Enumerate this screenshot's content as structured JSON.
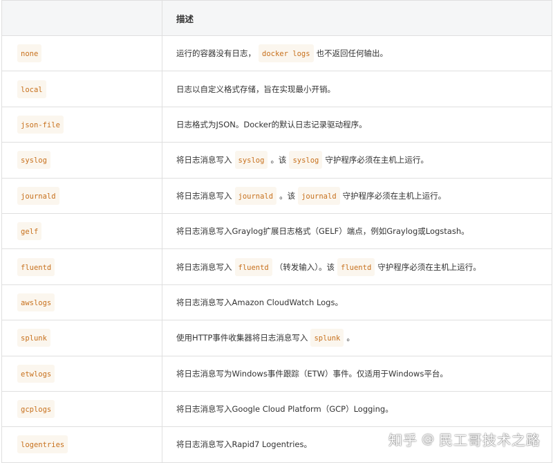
{
  "table": {
    "headers": [
      "",
      "描述"
    ],
    "rows": [
      {
        "name": "none",
        "desc": [
          {
            "t": "运行的容器没有日志，"
          },
          {
            "code": "docker logs"
          },
          {
            "t": "也不返回任何输出。"
          }
        ]
      },
      {
        "name": "local",
        "desc": [
          {
            "t": "日志以自定义格式存储，旨在实现最小开销。"
          }
        ]
      },
      {
        "name": "json-file",
        "desc": [
          {
            "t": "日志格式为JSON。Docker的默认日志记录驱动程序。"
          }
        ]
      },
      {
        "name": "syslog",
        "desc": [
          {
            "t": "将日志消息写入"
          },
          {
            "code": "syslog"
          },
          {
            "t": "。该"
          },
          {
            "code": "syslog"
          },
          {
            "t": "守护程序必须在主机上运行。"
          }
        ]
      },
      {
        "name": "journald",
        "desc": [
          {
            "t": "将日志消息写入"
          },
          {
            "code": "journald"
          },
          {
            "t": "。该"
          },
          {
            "code": "journald"
          },
          {
            "t": "守护程序必须在主机上运行。"
          }
        ]
      },
      {
        "name": "gelf",
        "desc": [
          {
            "t": "将日志消息写入Graylog扩展日志格式（GELF）端点，例如Graylog或Logstash。"
          }
        ]
      },
      {
        "name": "fluentd",
        "desc": [
          {
            "t": "将日志消息写入"
          },
          {
            "code": "fluentd"
          },
          {
            "t": "（转发输入）。该"
          },
          {
            "code": "fluentd"
          },
          {
            "t": "守护程序必须在主机上运行。"
          }
        ]
      },
      {
        "name": "awslogs",
        "desc": [
          {
            "t": "将日志消息写入Amazon CloudWatch Logs。"
          }
        ]
      },
      {
        "name": "splunk",
        "desc": [
          {
            "t": "使用HTTP事件收集器将日志消息写入"
          },
          {
            "code": "splunk"
          },
          {
            "t": "。"
          }
        ]
      },
      {
        "name": "etwlogs",
        "desc": [
          {
            "t": "将日志消息写为Windows事件跟踪（ETW）事件。仅适用于Windows平台。"
          }
        ]
      },
      {
        "name": "gcplogs",
        "desc": [
          {
            "t": "将日志消息写入Google Cloud Platform（GCP）Logging。"
          }
        ]
      },
      {
        "name": "logentries",
        "desc": [
          {
            "t": "将日志消息写入Rapid7 Logentries。"
          }
        ]
      }
    ]
  },
  "watermark": {
    "site": "知乎",
    "at": "@",
    "author": "民工哥技术之路"
  },
  "colors": {
    "code_text": "#c7701c",
    "code_bg": "#fbf6ee",
    "header_bg": "#f5f6f7",
    "border": "#dfdfdf"
  }
}
